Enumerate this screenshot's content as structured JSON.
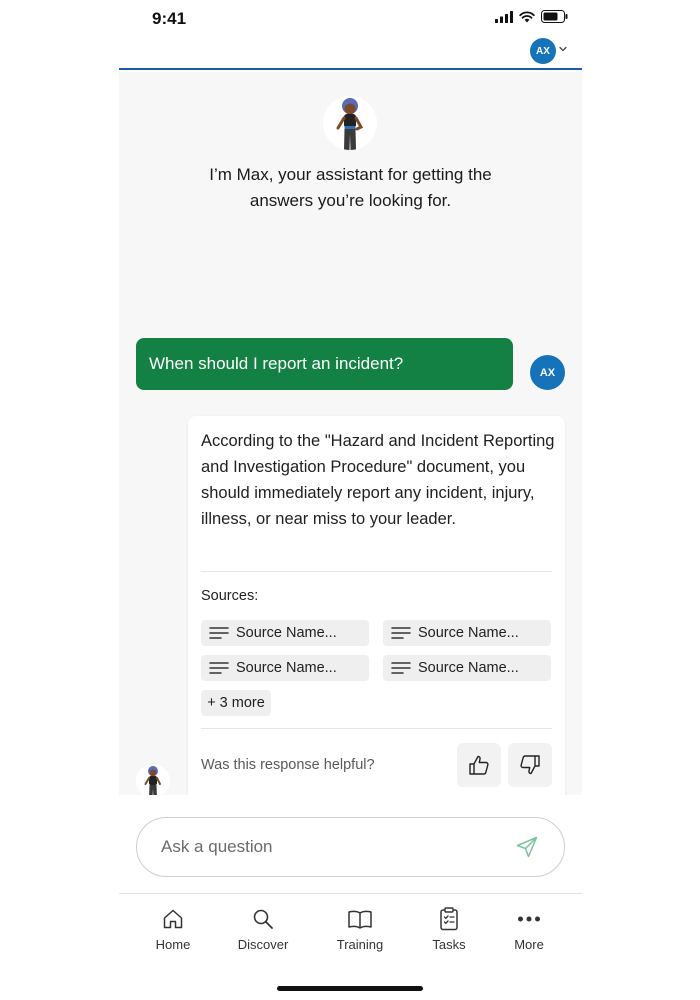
{
  "status": {
    "time": "9:41"
  },
  "header": {
    "avatar_initials": "AX"
  },
  "assistant": {
    "intro": "I’m Max, your assistant for getting the answers you’re looking for."
  },
  "conversation": {
    "user_message": "When should I report an incident?",
    "user_initials": "AX",
    "answer": "According to the \"Hazard and Incident Reporting and Investigation Procedure\" document, you should immediately report any incident, injury, illness, or near miss to your leader.",
    "sources_label": "Sources:",
    "sources": [
      "Source Name...",
      "Source Name...",
      "Source Name...",
      "Source Name..."
    ],
    "more_label": "+ 3 more",
    "feedback_prompt": "Was this response helpful?"
  },
  "composer": {
    "placeholder": "Ask a question"
  },
  "nav": {
    "items": [
      {
        "label": "Home",
        "icon": "home-icon"
      },
      {
        "label": "Discover",
        "icon": "search-icon"
      },
      {
        "label": "Training",
        "icon": "book-icon"
      },
      {
        "label": "Tasks",
        "icon": "clipboard-icon"
      },
      {
        "label": "More",
        "icon": "more-icon"
      }
    ]
  },
  "colors": {
    "accent_blue": "#1672b9",
    "user_bubble": "#138144",
    "header_rule": "#1f5aa6"
  }
}
